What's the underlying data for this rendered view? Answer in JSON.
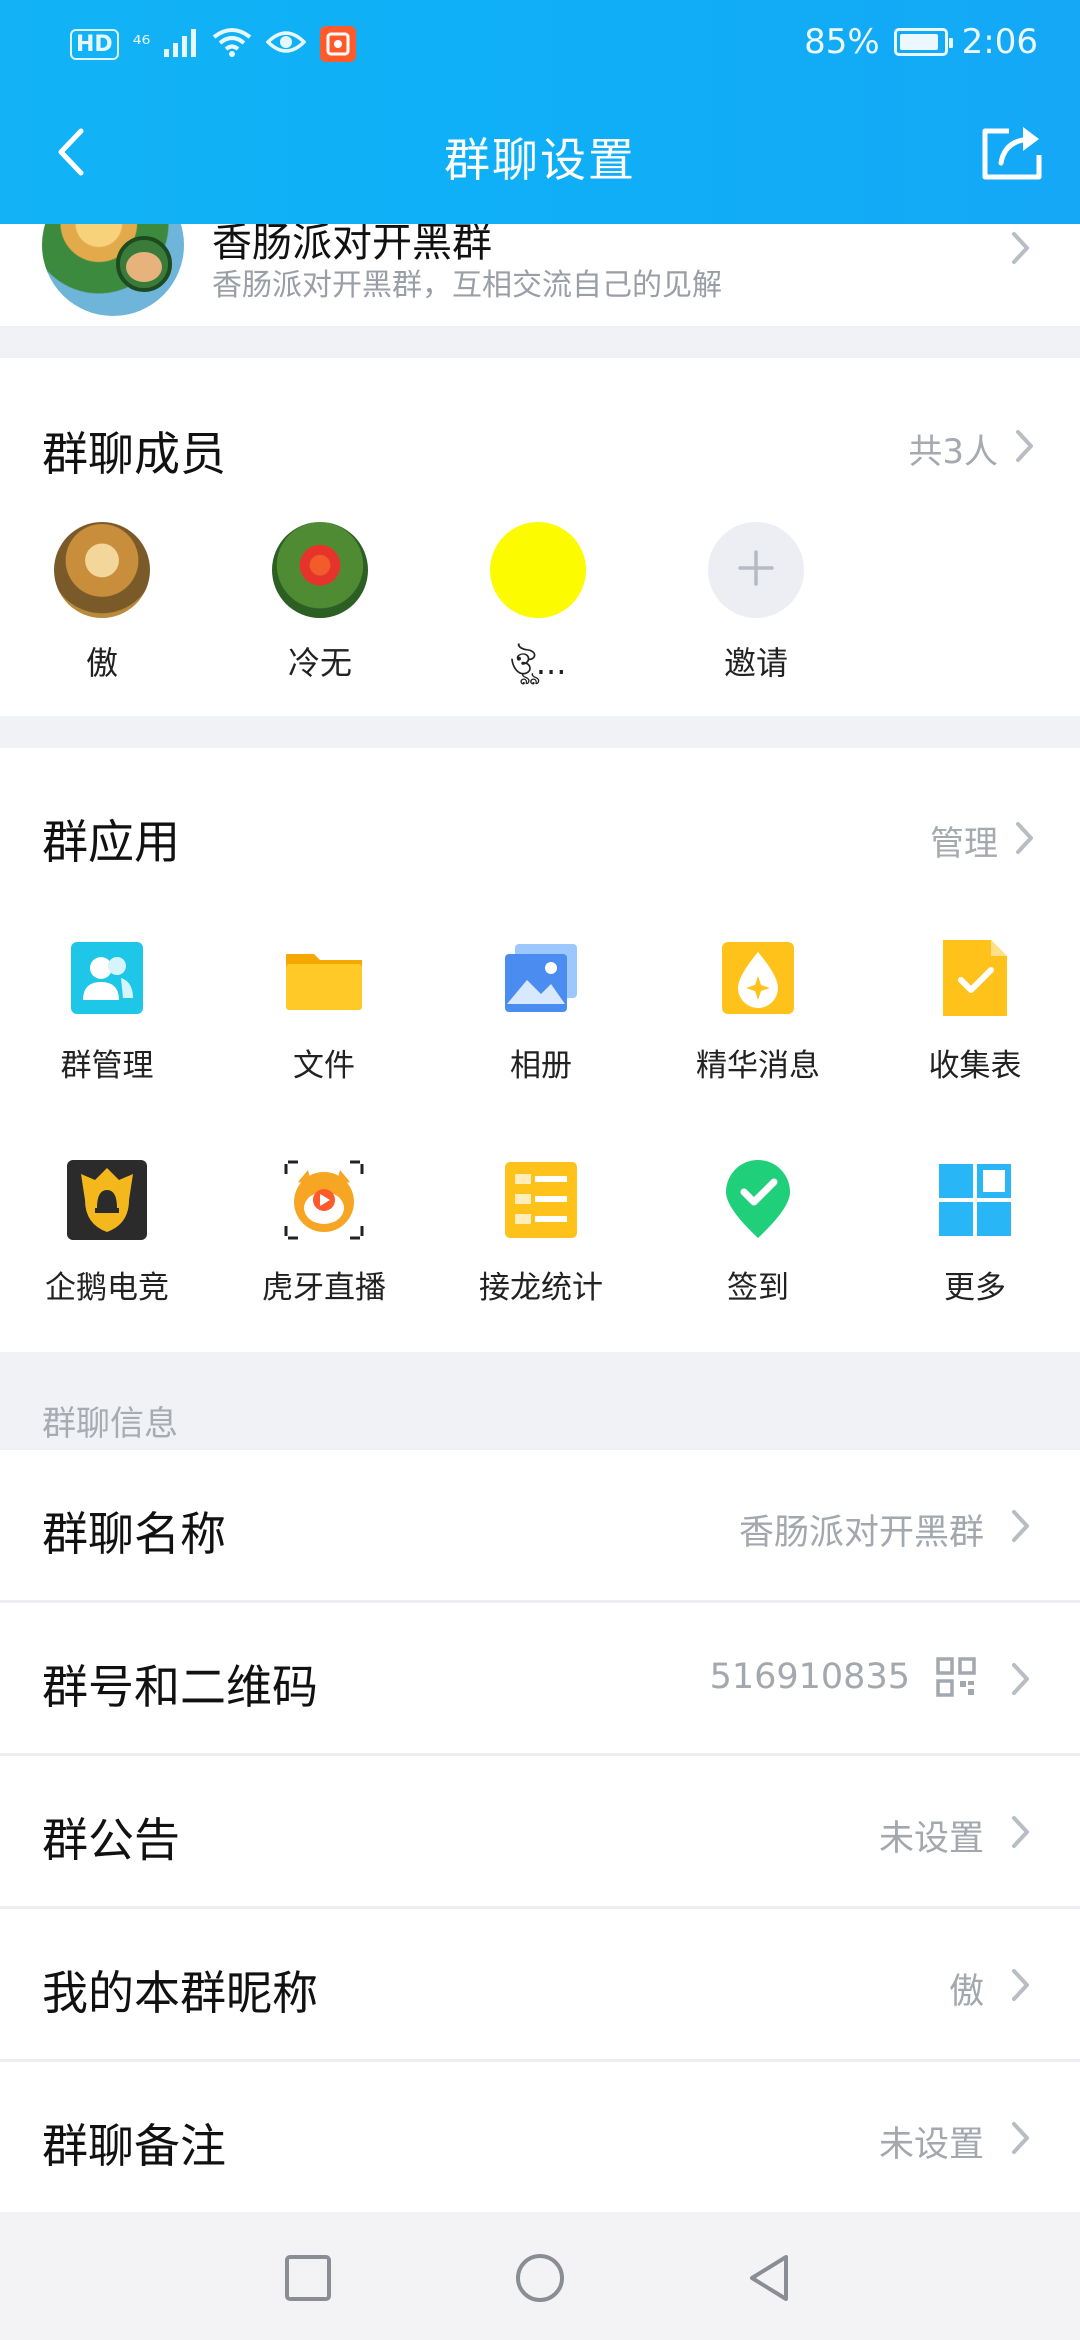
{
  "status_bar": {
    "hd": "HD",
    "signal": "⁴⁶",
    "battery": "85%",
    "time": "2:06",
    "icons": [
      "signal-icon",
      "wifi-icon",
      "eye-icon",
      "app-notification-icon",
      "battery-icon"
    ]
  },
  "header": {
    "title": "群聊设置",
    "back_icon": "chevron-left-icon",
    "share_icon": "share-icon"
  },
  "group": {
    "name_partial": "香肠派对开黑群",
    "description": "香肠派对开黑群，互相交流自己的见解"
  },
  "members": {
    "title": "群聊成员",
    "count": "共3人",
    "list": [
      {
        "name": "傲"
      },
      {
        "name": "冷无"
      },
      {
        "name": "ঔৣ..."
      },
      {
        "name": "邀请"
      }
    ]
  },
  "apps": {
    "title": "群应用",
    "manage": "管理",
    "items": [
      {
        "label": "群管理",
        "icon": "group-manage-icon",
        "color": "#1ec6e8"
      },
      {
        "label": "文件",
        "icon": "folder-icon",
        "color": "#fbc02d"
      },
      {
        "label": "相册",
        "icon": "album-icon",
        "color": "#4a8cf0"
      },
      {
        "label": "精华消息",
        "icon": "essence-icon",
        "color": "#ffc21a"
      },
      {
        "label": "收集表",
        "icon": "form-icon",
        "color": "#ffc21a"
      },
      {
        "label": "企鹅电竞",
        "icon": "penguin-esports-icon",
        "color": "#f5b81c"
      },
      {
        "label": "虎牙直播",
        "icon": "huya-icon",
        "color": "#f6a623"
      },
      {
        "label": "接龙统计",
        "icon": "relay-stats-icon",
        "color": "#ffc21a"
      },
      {
        "label": "签到",
        "icon": "checkin-icon",
        "color": "#1fcf7a"
      },
      {
        "label": "更多",
        "icon": "more-grid-icon",
        "color": "#29b6f6"
      }
    ]
  },
  "info": {
    "section_label": "群聊信息",
    "rows": [
      {
        "label": "群聊名称",
        "value": "香肠派对开黑群"
      },
      {
        "label": "群号和二维码",
        "value": "516910835"
      },
      {
        "label": "群公告",
        "value": "未设置"
      },
      {
        "label": "我的本群昵称",
        "value": "傲"
      },
      {
        "label": "群聊备注",
        "value": "未设置"
      }
    ]
  }
}
